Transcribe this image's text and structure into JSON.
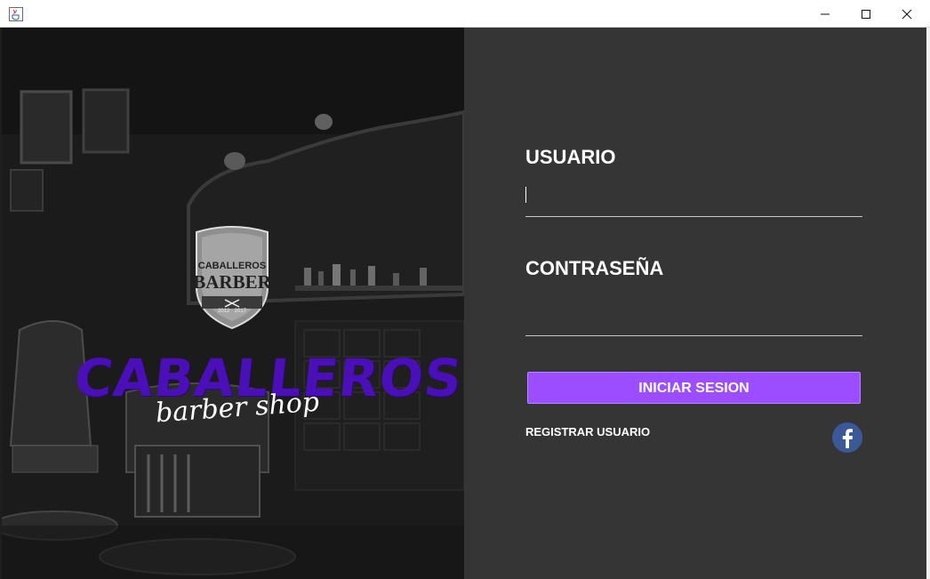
{
  "window": {
    "app_icon": "java-icon",
    "controls": [
      "minimize-icon",
      "maximize-icon",
      "close-icon"
    ]
  },
  "branding": {
    "badge_top": "CABALLEROS",
    "badge_main": "BARBER",
    "badge_sub": "SHOP",
    "badge_years": "2012  ·  2017",
    "wordmark": "CABALLEROS",
    "tagline": "barber shop",
    "wordmark_color": "#4b0fb8"
  },
  "login": {
    "user_label": "USUARIO",
    "user_value": "",
    "password_label": "CONTRASEÑA",
    "password_value": "",
    "submit_label": "INICIAR SESION",
    "register_label": "REGISTRAR USUARIO",
    "social_icon": "facebook-icon"
  },
  "colors": {
    "panel_background": "#353535",
    "button": "#9c4dff",
    "facebook": "#3b5998"
  }
}
